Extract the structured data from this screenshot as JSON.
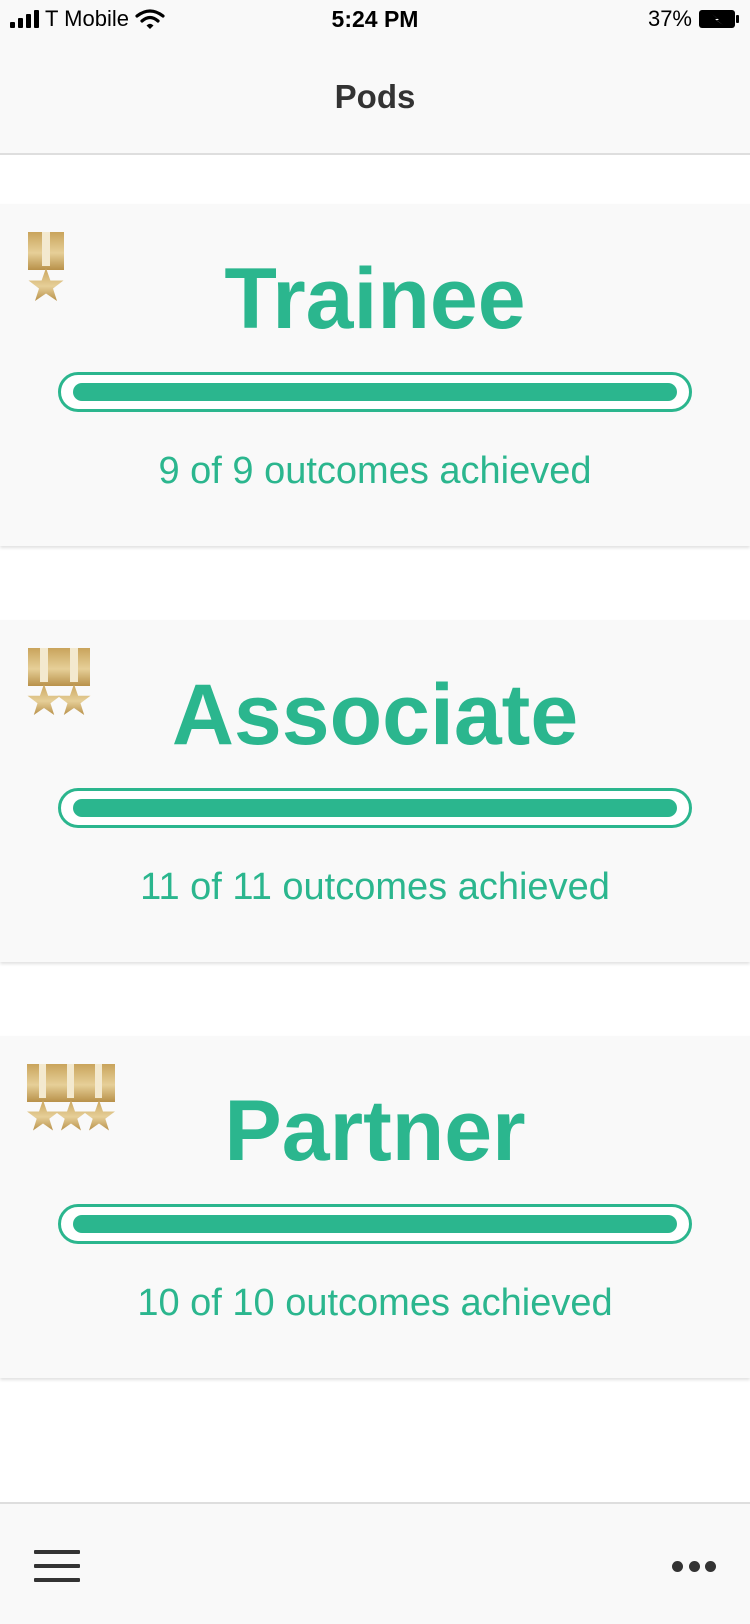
{
  "status_bar": {
    "carrier": "T Mobile",
    "time": "5:24 PM",
    "battery_percent": "37%"
  },
  "nav": {
    "title": "Pods"
  },
  "pods": [
    {
      "title": "Trainee",
      "outcomes_text": "9 of 9 outcomes achieved",
      "achieved": 9,
      "total": 9,
      "medal_icon": "single-star-medal-icon"
    },
    {
      "title": "Associate",
      "outcomes_text": "11 of 11 outcomes achieved",
      "achieved": 11,
      "total": 11,
      "medal_icon": "double-star-medal-icon"
    },
    {
      "title": "Partner",
      "outcomes_text": "10 of 10 outcomes achieved",
      "achieved": 10,
      "total": 10,
      "medal_icon": "triple-star-medal-icon"
    }
  ],
  "toolbar": {
    "menu_icon": "hamburger-menu-icon",
    "more_icon": "more-options-icon"
  },
  "colors": {
    "accent": "#2bb68e",
    "medal_gold": "#c9a45c"
  }
}
